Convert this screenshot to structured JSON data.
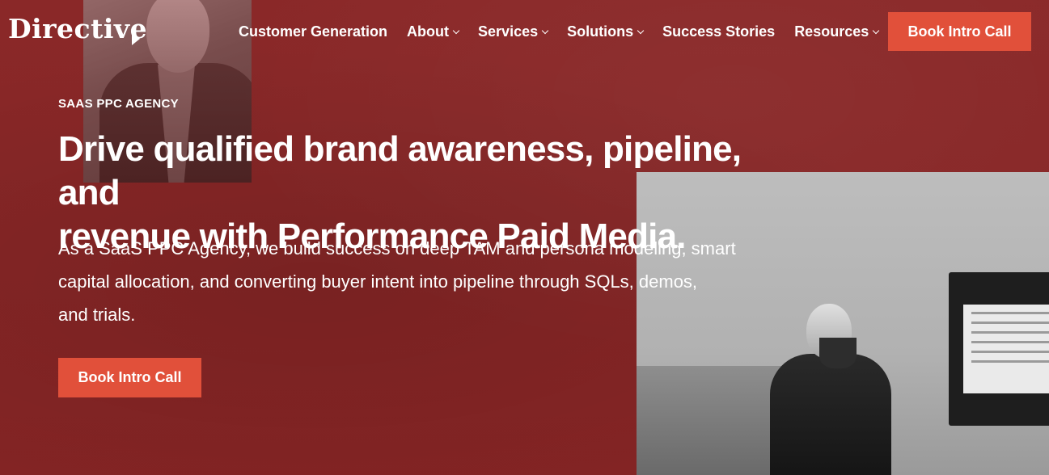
{
  "brand": {
    "logo_text": "Directive",
    "accent_color": "#e1503a",
    "background_color": "#862626"
  },
  "nav": {
    "items": [
      {
        "label": "Customer Generation",
        "has_dropdown": false
      },
      {
        "label": "About",
        "has_dropdown": true
      },
      {
        "label": "Services",
        "has_dropdown": true
      },
      {
        "label": "Solutions",
        "has_dropdown": true
      },
      {
        "label": "Success Stories",
        "has_dropdown": false
      },
      {
        "label": "Resources",
        "has_dropdown": true
      }
    ],
    "cta_label": "Book Intro Call"
  },
  "hero": {
    "eyebrow": "SAAS PPC AGENCY",
    "headline_line1": "Drive qualified brand awareness, pipeline, and",
    "headline_line2": "revenue with Performance Paid Media.",
    "subtext_line1": "As a SaaS PPC Agency, we build success on deep TAM and persona modeling, smart",
    "subtext_line2": "capital allocation, and converting buyer intent into pipeline through SQLs, demos,",
    "subtext_line3": "and trials.",
    "cta_label": "Book Intro Call"
  }
}
